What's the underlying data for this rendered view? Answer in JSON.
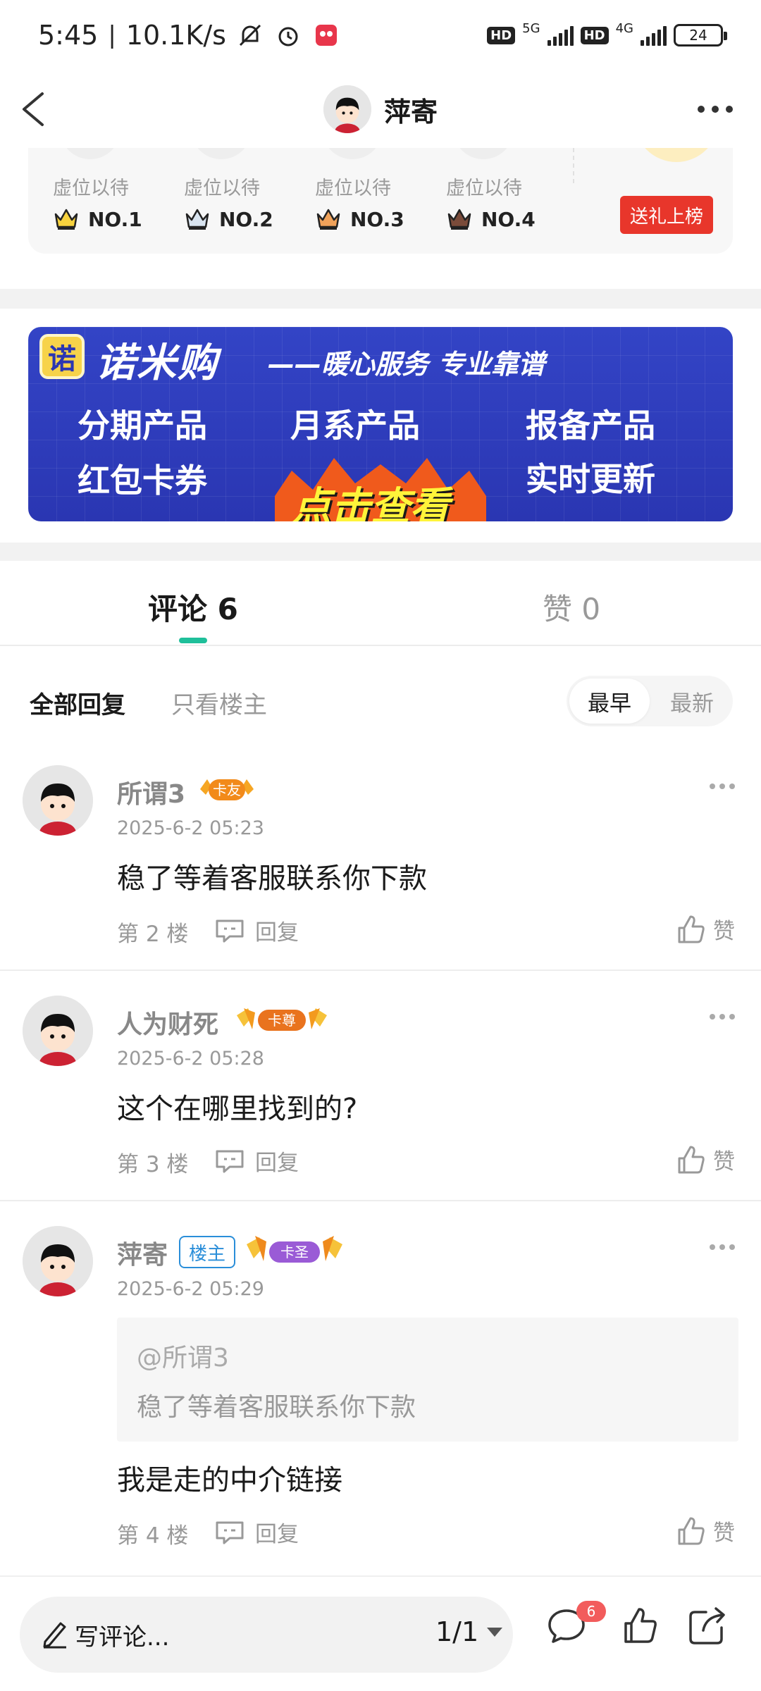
{
  "status_bar": {
    "time": "5:45",
    "speed": "10.1K/s",
    "net1": "5G",
    "net2": "4G",
    "hd": "HD",
    "battery": "24"
  },
  "nav": {
    "title": "萍寄"
  },
  "gift_ranking": {
    "slots": [
      {
        "label": "虚位以待",
        "rank": "NO.1"
      },
      {
        "label": "虚位以待",
        "rank": "NO.2"
      },
      {
        "label": "虚位以待",
        "rank": "NO.3"
      },
      {
        "label": "虚位以待",
        "rank": "NO.4"
      }
    ],
    "button": "送礼上榜"
  },
  "banner": {
    "logo": "诺",
    "title": "诺米购",
    "slogan": "——暖心服务 专业靠谱",
    "items": [
      "分期产品",
      "月系产品",
      "报备产品",
      "红包卡券",
      "实时更新"
    ],
    "cta": "点击查看"
  },
  "tabs": {
    "comments": "评论 6",
    "likes": "赞 0"
  },
  "filter": {
    "all": "全部回复",
    "op_only": "只看楼主",
    "sort_earliest": "最早",
    "sort_latest": "最新"
  },
  "comments": [
    {
      "name": "所谓3",
      "badge": "卡友",
      "time": "2025-6-2 05:23",
      "text": "稳了等着客服联系你下款",
      "floor": "第 2 楼",
      "reply": "回复",
      "like": "赞"
    },
    {
      "name": "人为财死",
      "badge": "卡尊",
      "time": "2025-6-2 05:28",
      "text": "这个在哪里找到的?",
      "floor": "第 3 楼",
      "reply": "回复",
      "like": "赞"
    },
    {
      "name": "萍寄",
      "owner_tag": "楼主",
      "badge": "卡圣",
      "time": "2025-6-2 05:29",
      "quote_user": "@所谓3",
      "quote_text": "稳了等着客服联系你下款",
      "text": "我是走的中介链接",
      "floor": "第 4 楼",
      "reply": "回复",
      "like": "赞"
    }
  ],
  "bottom_bar": {
    "write_placeholder": "写评论...",
    "page_indicator": "1/1",
    "comment_count": "6"
  },
  "colors": {
    "accent": "#1fbf9a",
    "gift_button": "#e8362b",
    "banner_bg": "#2a36b2",
    "badge_red": "#f25c5c",
    "owner_tag": "#2a8ed9"
  }
}
